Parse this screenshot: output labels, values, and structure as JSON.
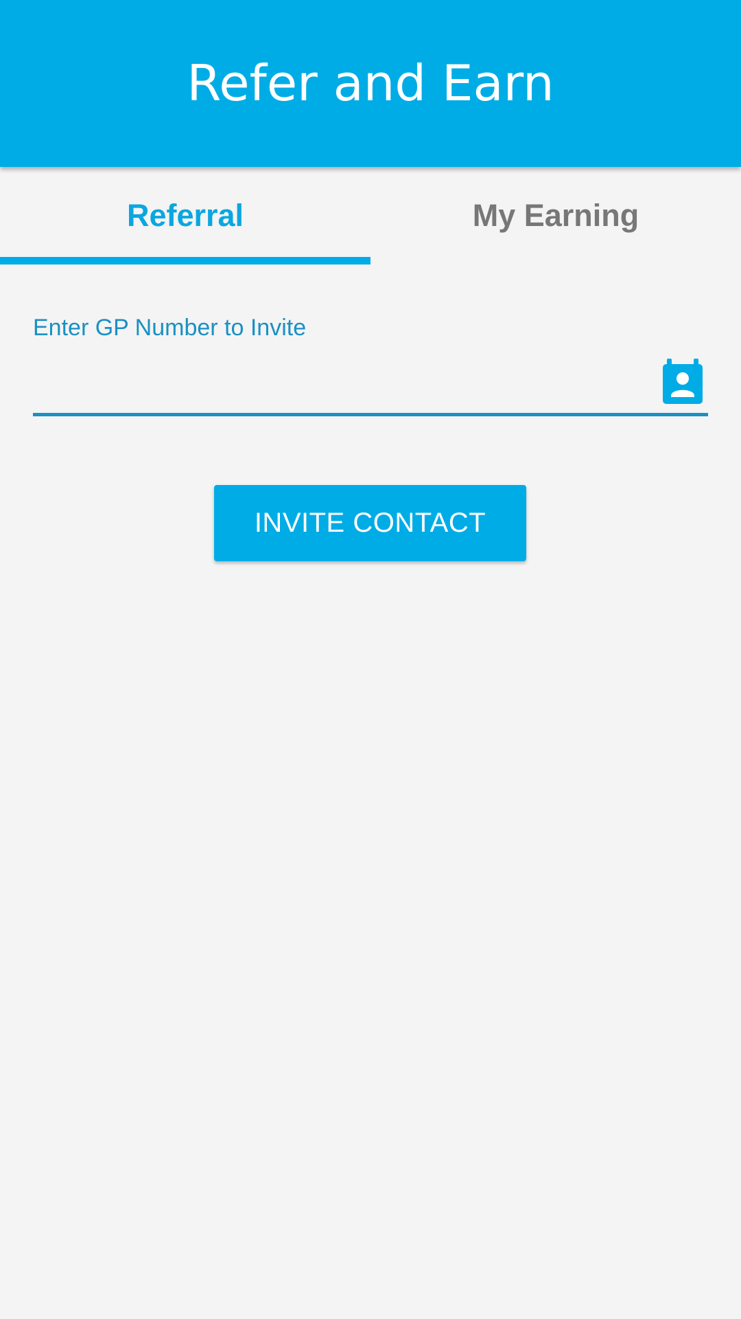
{
  "app_bar": {
    "title": "Refer and Earn",
    "color": "#00ace6"
  },
  "tabs": [
    {
      "label": "Referral",
      "selected": true
    },
    {
      "label": "My Earning",
      "selected": false
    }
  ],
  "referral_form": {
    "field_label": "Enter GP Number to Invite",
    "field_value": "",
    "contact_icon": "contact-book-icon",
    "invite_button_label": "INVITE CONTACT"
  },
  "colors": {
    "accent": "#00ace6",
    "field_accent": "#1a90c3",
    "inactive_tab": "#777777",
    "background": "#f4f4f4"
  }
}
